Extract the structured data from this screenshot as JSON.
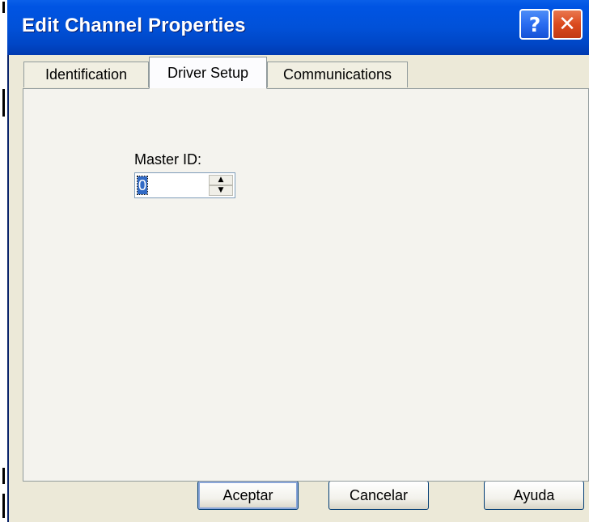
{
  "window": {
    "title": "Edit Channel Properties",
    "help_symbol": "?",
    "close_symbol": "✕"
  },
  "tabs": [
    {
      "label": "Identification",
      "active": false
    },
    {
      "label": "Driver Setup",
      "active": true
    },
    {
      "label": "Communications",
      "active": false
    }
  ],
  "driver_setup": {
    "master_id_label": "Master ID:",
    "master_id_value": "0",
    "spin_up": "▲",
    "spin_down": "▼"
  },
  "buttons": {
    "ok_label": "Aceptar",
    "cancel_label": "Cancelar",
    "help_label": "Ayuda"
  },
  "colors": {
    "titlebar_blue": "#0054e3",
    "close_red": "#db4a1e",
    "dialog_background": "#ece9d8",
    "selection_blue": "#316ac5"
  }
}
